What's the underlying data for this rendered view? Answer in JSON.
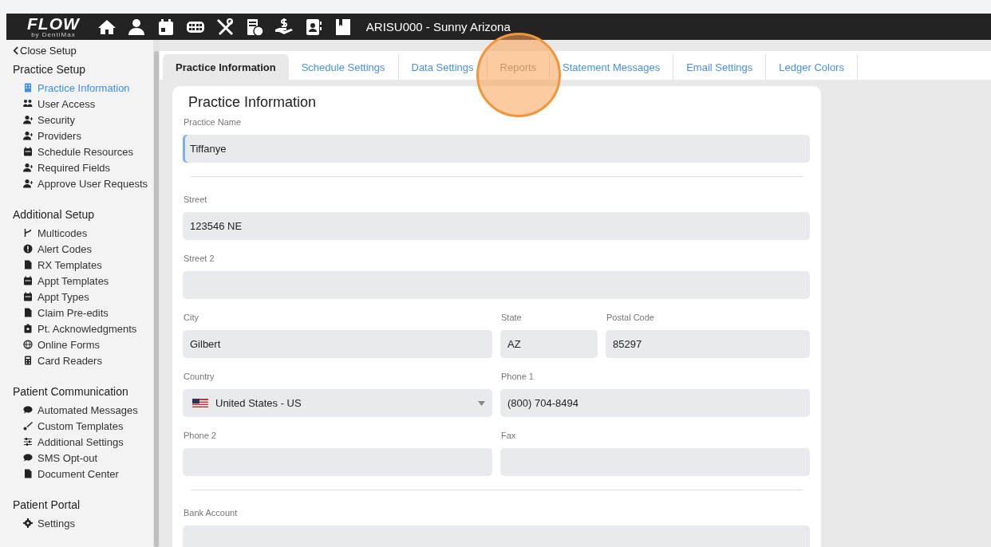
{
  "header": {
    "logo": "FLOW",
    "logo_sub": "by DentiMax",
    "nav_icons": [
      {
        "kind": "home"
      },
      {
        "kind": "person"
      },
      {
        "kind": "calendar"
      },
      {
        "kind": "teeth"
      },
      {
        "kind": "tools"
      },
      {
        "kind": "billing"
      },
      {
        "kind": "payment"
      },
      {
        "kind": "contacts"
      },
      {
        "kind": "book"
      }
    ],
    "title": "ARISU000 - Sunny Arizona"
  },
  "sidebar": {
    "close_link": "Close Setup",
    "sections": [
      {
        "title": "Practice Setup",
        "items": [
          {
            "label": "Practice Information",
            "kind": "building",
            "selected": true
          },
          {
            "label": "User Access",
            "kind": "users",
            "selected": false
          },
          {
            "label": "Security",
            "kind": "person",
            "selected": false
          },
          {
            "label": "Providers",
            "kind": "person",
            "selected": false
          },
          {
            "label": "Schedule Resources",
            "kind": "calendar",
            "selected": false
          },
          {
            "label": "Required Fields",
            "kind": "person",
            "selected": false
          },
          {
            "label": "Approve User Requests",
            "kind": "person",
            "selected": false
          }
        ]
      },
      {
        "title": "Additional Setup",
        "items": [
          {
            "label": "Multicodes",
            "kind": "branch",
            "selected": false
          },
          {
            "label": "Alert Codes",
            "kind": "alert",
            "selected": false
          },
          {
            "label": "RX Templates",
            "kind": "document",
            "selected": false
          },
          {
            "label": "Appt Templates",
            "kind": "calendar",
            "selected": false
          },
          {
            "label": "Appt Types",
            "kind": "calendar",
            "selected": false
          },
          {
            "label": "Claim Pre-edits",
            "kind": "document",
            "selected": false
          },
          {
            "label": "Pt. Acknowledgments",
            "kind": "badge",
            "selected": false
          },
          {
            "label": "Online Forms",
            "kind": "globe",
            "selected": false
          },
          {
            "label": "Card Readers",
            "kind": "calculator",
            "selected": false
          }
        ]
      },
      {
        "title": "Patient Communication",
        "items": [
          {
            "label": "Automated Messages",
            "kind": "chat",
            "selected": false
          },
          {
            "label": "Custom Templates",
            "kind": "brush",
            "selected": false
          },
          {
            "label": "Additional Settings",
            "kind": "sliders",
            "selected": false
          },
          {
            "label": "SMS Opt-out",
            "kind": "chat",
            "selected": false
          },
          {
            "label": "Document Center",
            "kind": "document",
            "selected": false
          }
        ]
      },
      {
        "title": "Patient Portal",
        "items": [
          {
            "label": "Settings",
            "kind": "gear",
            "selected": false
          }
        ]
      }
    ]
  },
  "tabs": [
    {
      "label": "Practice Information",
      "selected": true,
      "highlighted": false
    },
    {
      "label": "Schedule Settings",
      "selected": false,
      "highlighted": false
    },
    {
      "label": "Data Settings",
      "selected": false,
      "highlighted": false
    },
    {
      "label": "Reports",
      "selected": false,
      "highlighted": true
    },
    {
      "label": "Statement Messages",
      "selected": false,
      "highlighted": false
    },
    {
      "label": "Email Settings",
      "selected": false,
      "highlighted": false
    },
    {
      "label": "Ledger Colors",
      "selected": false,
      "highlighted": false
    }
  ],
  "form": {
    "title": "Practice Information",
    "rows": [
      {
        "kind": "fields",
        "fields": [
          {
            "label": "Practice Name",
            "value": "Tiffanye",
            "kind": "text",
            "focused": true
          }
        ]
      },
      {
        "kind": "divider"
      },
      {
        "kind": "fields",
        "fields": [
          {
            "label": "Street",
            "value": "123546 NE",
            "kind": "text",
            "focused": false
          }
        ]
      },
      {
        "kind": "fields",
        "fields": [
          {
            "label": "Street 2",
            "kind": "text",
            "focused": false
          }
        ]
      },
      {
        "kind": "fields",
        "fields": [
          {
            "label": "City",
            "value": "Gilbert",
            "kind": "text",
            "focused": false
          },
          {
            "label": "State",
            "value": "AZ",
            "kind": "text",
            "focused": false
          },
          {
            "label": "Postal Code",
            "value": "85297",
            "kind": "text",
            "focused": false
          }
        ]
      },
      {
        "kind": "fields",
        "fields": [
          {
            "label": "Country",
            "value": "United States - US",
            "kind": "country_select",
            "focused": false
          },
          {
            "label": "Phone 1",
            "value": "(800) 704-8494",
            "kind": "text",
            "focused": false
          }
        ]
      },
      {
        "kind": "fields",
        "fields": [
          {
            "label": "Phone 2",
            "kind": "text",
            "focused": false
          },
          {
            "label": "Fax",
            "kind": "text",
            "focused": false
          }
        ]
      },
      {
        "kind": "divider"
      },
      {
        "kind": "fields",
        "fields": [
          {
            "label": "Bank Account",
            "kind": "text",
            "focused": false
          }
        ]
      }
    ]
  }
}
